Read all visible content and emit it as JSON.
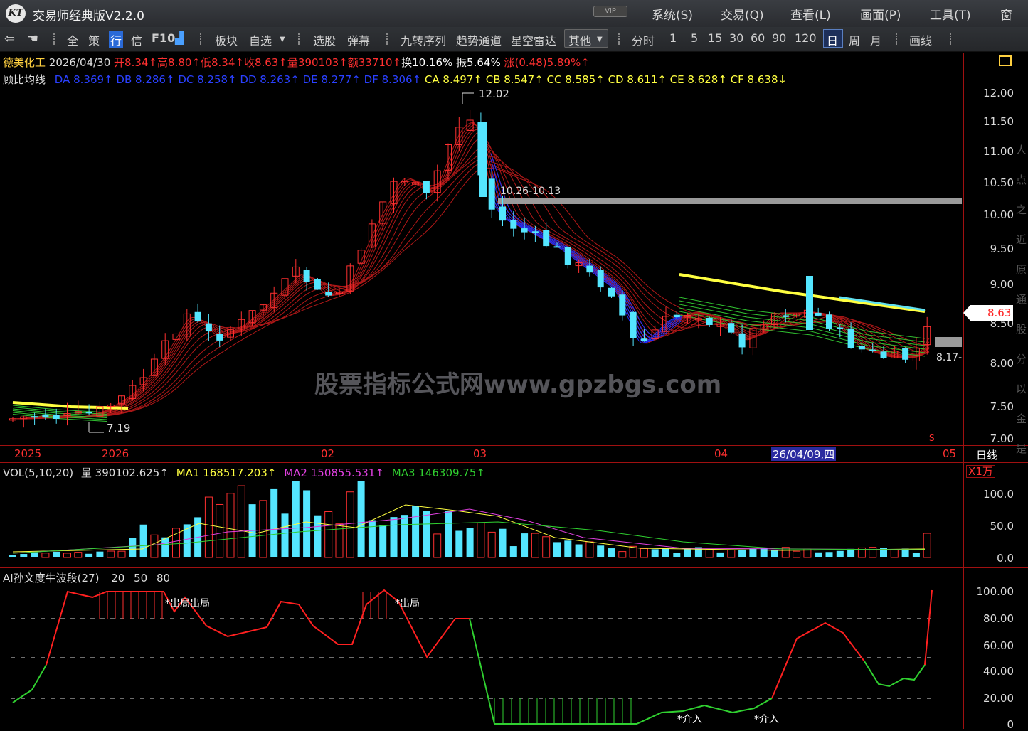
{
  "app": {
    "title": "交易师经典版V2.2.0",
    "vip": "VIP",
    "logo": "KT",
    "menu": [
      "系统(S)",
      "交易(Q)",
      "查看(L)",
      "画面(P)",
      "工具(T)",
      "窗"
    ]
  },
  "toolbar": {
    "items": [
      "全",
      "策",
      "行",
      "信",
      "F10",
      "板块",
      "自选",
      "选股",
      "弹幕",
      "九转序列",
      "趋势通道",
      "星空雷达",
      "其他",
      "分时",
      "1",
      "5",
      "15",
      "30",
      "60",
      "90",
      "120",
      "日",
      "周",
      "月",
      "画线"
    ],
    "active_period": "日"
  },
  "stock": {
    "name": "德美化工",
    "date": "2026/04/30",
    "open": "开8.34↑",
    "high": "高8.80↑",
    "low": "低8.34↑",
    "close": "收8.63↑",
    "volume": "量390103↑",
    "amount": "额33710↑",
    "turnover": "换10.16%",
    "amplitude": "振5.64%",
    "change": "涨(0.48)5.89%↑"
  },
  "indicator_main": {
    "name": "顾比均线",
    "short": [
      "DA 8.369↑",
      "DB 8.286↑",
      "DC 8.258↑",
      "DD 8.263↑",
      "DE 8.277↑",
      "DF 8.306↑"
    ],
    "long": [
      "CA 8.497↑",
      "CB 8.547↑",
      "CC 8.585↑",
      "CD 8.611↑",
      "CE 8.628↑",
      "CF 8.638↓"
    ]
  },
  "price_axis": [
    "12.00",
    "11.50",
    "11.00",
    "10.50",
    "10.00",
    "9.50",
    "9.00",
    "8.50",
    "8.00",
    "7.50",
    "7.00"
  ],
  "price_annotations": {
    "high": "12.02",
    "low": "7.19",
    "range": "10.26-10.13",
    "current": "8.63",
    "target": "8.17-8",
    "marker": "S"
  },
  "watermark": "股票指标公式网www.gpzbgs.com",
  "date_axis": {
    "labels": [
      "2025",
      "2026",
      "02",
      "03",
      "04",
      "05"
    ],
    "cursor": "26/04/09,四",
    "period": "日线"
  },
  "volume": {
    "title": "VOL(5,10,20)",
    "vol": "量 390102.625↑",
    "ma1": "MA1 168517.203↑",
    "ma2": "MA2 150855.531↑",
    "ma3": "MA3 146309.75↑",
    "unit": "X1万",
    "axis": [
      "100.0",
      "50.0",
      "0.0"
    ]
  },
  "oscillator": {
    "title": "AI孙文度牛波段(27)",
    "levels": [
      "20",
      "50",
      "80"
    ],
    "axis": [
      "100.00",
      "80.00",
      "60.00",
      "40.00",
      "20.00",
      "0"
    ],
    "signals": {
      "exit1": "*出局出局",
      "exit2": "*出局",
      "enter1": "*介入",
      "enter2": "*介入"
    }
  },
  "colors": {
    "up": "#ff3030",
    "down": "#54e6ff",
    "ma_long": "#b01818",
    "ma_short_blue": "#2030ff",
    "yellow": "#ffff40",
    "green": "#30c030",
    "grid": "#a01010"
  }
}
